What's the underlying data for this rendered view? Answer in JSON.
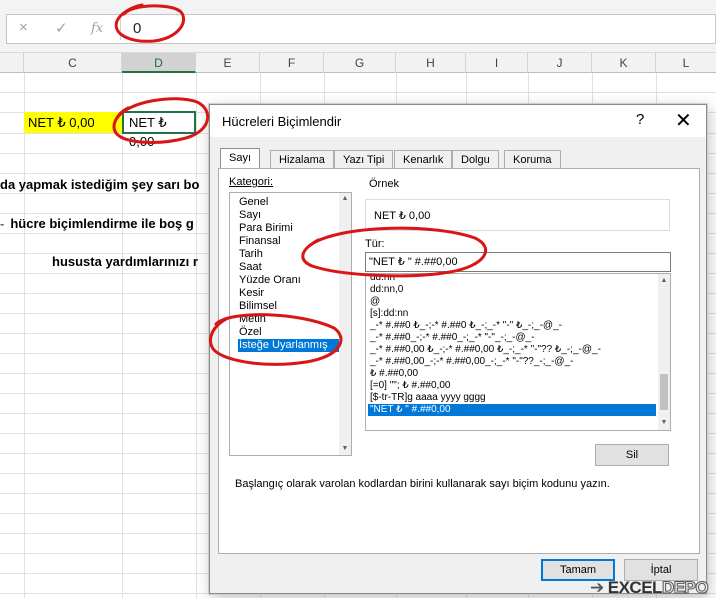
{
  "formula_bar": {
    "cancel_icon": "×",
    "enter_icon": "✓",
    "fx_icon": "fx",
    "value": "0"
  },
  "columns": [
    "C",
    "D",
    "E",
    "F",
    "G",
    "H",
    "I",
    "J",
    "K",
    "L"
  ],
  "cells": {
    "c_value": "NET ₺ 0,00",
    "d_value": "NET ₺  0,00"
  },
  "sheet_texts": {
    "line1": "da yapmak istediğim şey sarı bo",
    "line2": "hücre biçimlendirme ile boş g",
    "line3": "husustа yardımlarınızı r"
  },
  "dialog": {
    "title": "Hücreleri Biçimlendir",
    "help": "?",
    "close": "✕",
    "tabs": [
      "Sayı",
      "Hizalama",
      "Yazı Tipi",
      "Kenarlık",
      "Dolgu",
      "Koruma"
    ],
    "category_label": "Kategori:",
    "categories": [
      "Genel",
      "Sayı",
      "Para Birimi",
      "Finansal",
      "Tarih",
      "Saat",
      "Yüzde Oranı",
      "Kesir",
      "Bilimsel",
      "Metin",
      "Özel",
      "İsteğe Uyarlanmış"
    ],
    "selected_category": "İsteğe Uyarlanmış",
    "sample_label": "Örnek",
    "sample_value": "NET ₺  0,00",
    "type_label": "Tür:",
    "type_value": "\"NET ₺ \" #.##0,00",
    "formats": [
      "dd:nn",
      "dd:nn,0",
      "@",
      "[s]:dd:nn",
      "_-* #.##0 ₺_-;-* #.##0 ₺_-;_-* \"-\" ₺_-;_-@_-",
      "_-* #.##0_-;-* #.##0_-;_-* \"-\"_-;_-@_-",
      "_-* #.##0,00 ₺_-;-* #.##0,00 ₺_-;_-* \"-\"?? ₺_-;_-@_-",
      "_-* #.##0,00_-;-* #.##0,00_-;_-* \"-\"??_-;_-@_-",
      "₺ #.##0,00",
      "[=0] \"\"; ₺ #.##0,00",
      "[$-tr-TR]g aaaa yyyy gggg",
      "\"NET ₺ \" #.##0,00"
    ],
    "delete_button": "Sil",
    "hint": "Başlangıç olarak varolan kodlardan birini kullanarak sayı biçim kodunu yazın.",
    "ok_button": "Tamam",
    "cancel_button": "İptal"
  },
  "watermark": {
    "arrow": "➔",
    "part1": "EXCEL",
    "part2": "DEPO"
  },
  "colors": {
    "excel_green": "#217346",
    "selection_blue": "#0078d7",
    "highlight_yellow": "#ffff00",
    "annotation_red": "#d81616"
  }
}
